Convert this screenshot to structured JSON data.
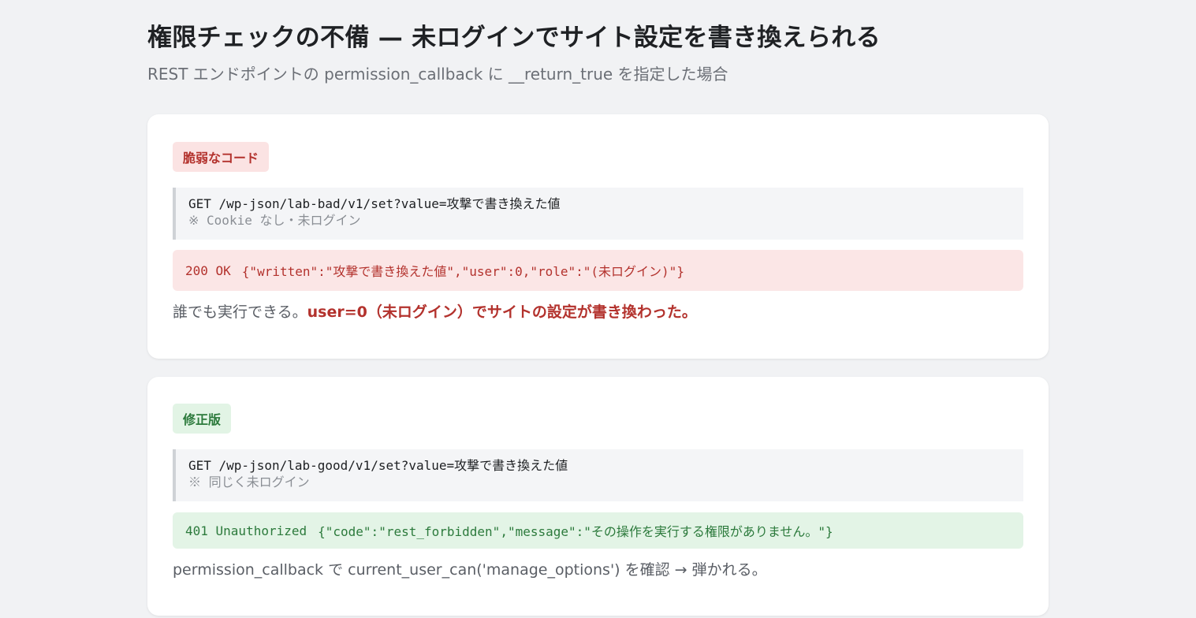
{
  "header": {
    "title": "権限チェックの不備 — 未ログインでサイト設定を書き換えられる",
    "subtitle": "REST エンドポイントの permission_callback に __return_true を指定した場合"
  },
  "cards": {
    "bad": {
      "badge": "脆弱なコード",
      "request_line": "GET /wp-json/lab-bad/v1/set?value=攻撃で書き換えた値",
      "request_note": "※ Cookie なし・未ログイン",
      "response_status": "200 OK",
      "response_body": "{\"written\":\"攻撃で書き換えた値\",\"user\":0,\"role\":\"(未ログイン)\"}",
      "note_plain": "誰でも実行できる。",
      "note_emph": "user=0（未ログイン）でサイトの設定が書き換わった。"
    },
    "good": {
      "badge": "修正版",
      "request_line": "GET /wp-json/lab-good/v1/set?value=攻撃で書き換えた値",
      "request_note": "※ 同じく未ログイン",
      "response_status": "401 Unauthorized",
      "response_body": "{\"code\":\"rest_forbidden\",\"message\":\"その操作を実行する権限がありません。\"}",
      "note_plain": "permission_callback で current_user_can('manage_options') を確認 → 弾かれる。"
    }
  },
  "colors": {
    "danger": "#b3322d",
    "danger_bg": "#fbe6e6",
    "success": "#2c7a3c",
    "success_bg": "#e3f4e6",
    "page_bg": "#f1f2f4"
  }
}
